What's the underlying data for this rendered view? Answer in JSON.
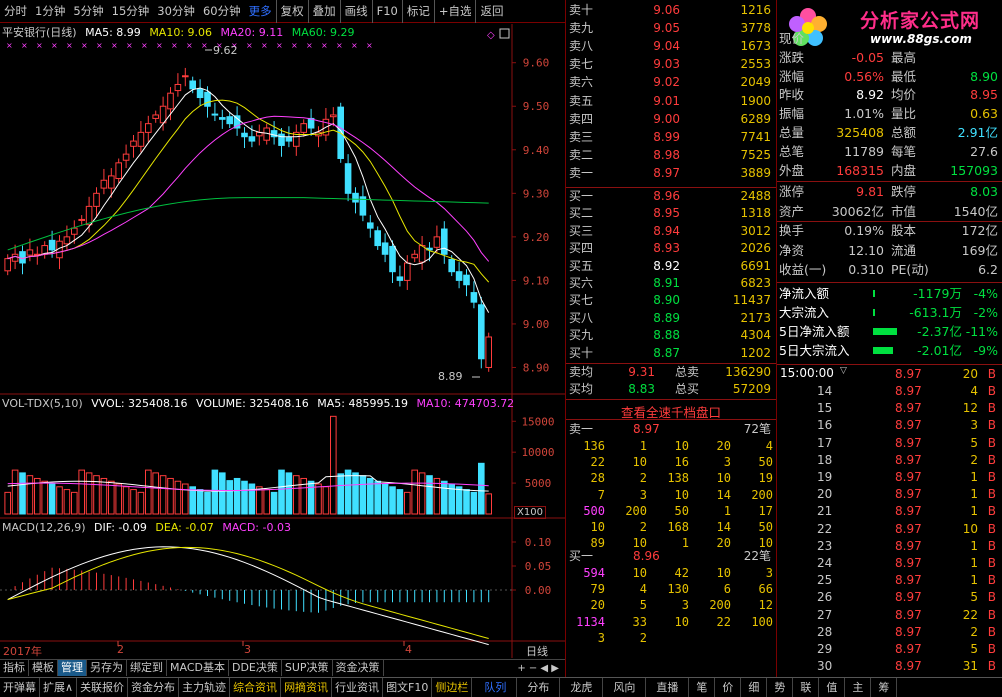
{
  "toolbar": {
    "periods": [
      "分时",
      "1分钟",
      "5分钟",
      "15分钟",
      "30分钟",
      "60分钟"
    ],
    "more": "更多",
    "buttons": [
      "复权",
      "叠加",
      "画线",
      "F10",
      "标记",
      "+自选",
      "返回"
    ]
  },
  "chart_header": {
    "name": "平安银行(日线)",
    "ma5": "MA5: 8.99",
    "ma10": "MA10: 9.06",
    "ma20": "MA20: 9.11",
    "ma60": "MA60: 9.29"
  },
  "price_axis": [
    "9.60",
    "9.50",
    "9.40",
    "9.30",
    "9.20",
    "9.10",
    "9.00",
    "8.90"
  ],
  "high_label": "9.62",
  "low_label": "8.89",
  "vol_header": {
    "name": "VOL-TDX(5,10)",
    "vvol": "VVOL: 325408.16",
    "volume": "VOLUME: 325408.16",
    "ma5": "MA5: 485995.19",
    "ma10": "MA10: 474703.72"
  },
  "vol_axis": [
    "15000",
    "10000",
    "5000"
  ],
  "vol_unit": "X100",
  "macd_header": {
    "name": "MACD(12,26,9)",
    "dif": "DIF: -0.09",
    "dea": "DEA: -0.07",
    "macd": "MACD: -0.03"
  },
  "macd_axis": [
    "0.10",
    "0.05",
    "0.00"
  ],
  "date_axis": {
    "year": "2017年",
    "m2": "2",
    "m3": "3",
    "m4": "4",
    "period": "日线"
  },
  "bottom_tabs": [
    "指标",
    "模板",
    "管理",
    "另存为",
    "绑定到",
    "MACD基本",
    "DDE决策",
    "SUP决策",
    "资金决策"
  ],
  "status_bar": [
    "开弹幕",
    "扩展∧",
    "关联报价",
    "资金分布",
    "主力轨迹",
    "综合资讯",
    "网摘资讯",
    "行业资讯",
    "图文F10",
    "侧边栏"
  ],
  "status_bar_right": [
    "队列",
    "分布",
    "龙虎",
    "风向",
    "直播",
    "笔",
    "价",
    "细",
    "势",
    "联",
    "值",
    "主",
    "筹"
  ],
  "order_book": {
    "asks": [
      {
        "label": "卖十",
        "price": "9.06",
        "vol": "1216"
      },
      {
        "label": "卖九",
        "price": "9.05",
        "vol": "3778"
      },
      {
        "label": "卖八",
        "price": "9.04",
        "vol": "1673"
      },
      {
        "label": "卖七",
        "price": "9.03",
        "vol": "2553"
      },
      {
        "label": "卖六",
        "price": "9.02",
        "vol": "2049"
      },
      {
        "label": "卖五",
        "price": "9.01",
        "vol": "1900"
      },
      {
        "label": "卖四",
        "price": "9.00",
        "vol": "6289"
      },
      {
        "label": "卖三",
        "price": "8.99",
        "vol": "7741"
      },
      {
        "label": "卖二",
        "price": "8.98",
        "vol": "7525"
      },
      {
        "label": "卖一",
        "price": "8.97",
        "vol": "3889"
      }
    ],
    "bids": [
      {
        "label": "买一",
        "price": "8.96",
        "vol": "2488"
      },
      {
        "label": "买二",
        "price": "8.95",
        "vol": "1318"
      },
      {
        "label": "买三",
        "price": "8.94",
        "vol": "3012"
      },
      {
        "label": "买四",
        "price": "8.93",
        "vol": "2026"
      },
      {
        "label": "买五",
        "price": "8.92",
        "vol": "6691"
      },
      {
        "label": "买六",
        "price": "8.91",
        "vol": "6823"
      },
      {
        "label": "买七",
        "price": "8.90",
        "vol": "11437"
      },
      {
        "label": "买八",
        "price": "8.89",
        "vol": "2173"
      },
      {
        "label": "买九",
        "price": "8.88",
        "vol": "4304"
      },
      {
        "label": "买十",
        "price": "8.87",
        "vol": "1202"
      }
    ],
    "sell_avg": {
      "label": "卖均",
      "price": "9.31",
      "tlabel": "总卖",
      "vol": "136290"
    },
    "buy_avg": {
      "label": "买均",
      "price": "8.83",
      "tlabel": "总买",
      "vol": "57209"
    }
  },
  "queue_link": "查看全速千档盘口",
  "ask_queue": {
    "label": "卖一",
    "price": "8.97",
    "count": "72笔",
    "rows": [
      [
        "136",
        "1",
        "10",
        "20",
        "4"
      ],
      [
        "22",
        "10",
        "16",
        "3",
        "50"
      ],
      [
        "28",
        "2",
        "138",
        "10",
        "19"
      ],
      [
        "7",
        "3",
        "10",
        "14",
        "200"
      ],
      [
        "500",
        "200",
        "50",
        "1",
        "17"
      ],
      [
        "10",
        "2",
        "168",
        "14",
        "50"
      ],
      [
        "89",
        "10",
        "1",
        "20",
        "10"
      ]
    ]
  },
  "bid_queue": {
    "label": "买一",
    "price": "8.96",
    "count": "22笔",
    "rows": [
      [
        "594",
        "10",
        "42",
        "10",
        "3"
      ],
      [
        "79",
        "4",
        "130",
        "6",
        "66"
      ],
      [
        "20",
        "5",
        "3",
        "200",
        "12"
      ],
      [
        "1134",
        "33",
        "10",
        "22",
        "100"
      ],
      [
        "3",
        "2",
        "",
        "",
        ""
      ]
    ]
  },
  "logo": {
    "title": "分析家公式网",
    "url": "www.88gs.com"
  },
  "quote": [
    {
      "l1": "现价",
      "v1": "",
      "l2": "",
      "v2": ""
    },
    {
      "l1": "涨跌",
      "v1": "-0.05",
      "l2": "最高",
      "v2": ""
    },
    {
      "l1": "涨幅",
      "v1": "0.56%",
      "l2": "最低",
      "v2": "8.90"
    },
    {
      "l1": "昨收",
      "v1": "8.92",
      "l2": "均价",
      "v2": "8.95"
    },
    {
      "l1": "振幅",
      "v1": "1.01%",
      "l2": "量比",
      "v2": "0.63"
    },
    {
      "l1": "总量",
      "v1": "325408",
      "l2": "总额",
      "v2": "2.91亿"
    },
    {
      "l1": "总笔",
      "v1": "11789",
      "l2": "每笔",
      "v2": "27.6"
    },
    {
      "l1": "外盘",
      "v1": "168315",
      "l2": "内盘",
      "v2": "157093"
    }
  ],
  "quote2": [
    {
      "l1": "涨停",
      "v1": "9.81",
      "l2": "跌停",
      "v2": "8.03"
    },
    {
      "l1": "资产",
      "v1": "30062亿",
      "l2": "市值",
      "v2": "1540亿"
    },
    {
      "l1": "换手",
      "v1": "0.19%",
      "l2": "股本",
      "v2": "172亿"
    },
    {
      "l1": "净资",
      "v1": "12.10",
      "l2": "流通",
      "v2": "169亿"
    },
    {
      "l1": "收益(一)",
      "v1": "0.310",
      "l2": "PE(动)",
      "v2": "6.2"
    }
  ],
  "flows": [
    {
      "label": "净流入额",
      "value": "-1179万",
      "pct": "-4%"
    },
    {
      "label": "大宗流入",
      "value": "-613.1万",
      "pct": "-2%"
    },
    {
      "label": "5日净流入额",
      "value": "-2.37亿",
      "pct": "-11%"
    },
    {
      "label": "5日大宗流入",
      "value": "-2.01亿",
      "pct": "-9%"
    }
  ],
  "ticks_header": "15:00:00",
  "ticks": [
    {
      "t": "14",
      "p": "8.97",
      "v": "4",
      "d": "B"
    },
    {
      "t": "15",
      "p": "8.97",
      "v": "12",
      "d": "B"
    },
    {
      "t": "16",
      "p": "8.97",
      "v": "3",
      "d": "B"
    },
    {
      "t": "17",
      "p": "8.97",
      "v": "5",
      "d": "B"
    },
    {
      "t": "18",
      "p": "8.97",
      "v": "2",
      "d": "B"
    },
    {
      "t": "19",
      "p": "8.97",
      "v": "1",
      "d": "B"
    },
    {
      "t": "20",
      "p": "8.97",
      "v": "1",
      "d": "B"
    },
    {
      "t": "21",
      "p": "8.97",
      "v": "1",
      "d": "B"
    },
    {
      "t": "22",
      "p": "8.97",
      "v": "10",
      "d": "B"
    },
    {
      "t": "23",
      "p": "8.97",
      "v": "1",
      "d": "B"
    },
    {
      "t": "24",
      "p": "8.97",
      "v": "1",
      "d": "B"
    },
    {
      "t": "25",
      "p": "8.97",
      "v": "1",
      "d": "B"
    },
    {
      "t": "26",
      "p": "8.97",
      "v": "5",
      "d": "B"
    },
    {
      "t": "27",
      "p": "8.97",
      "v": "22",
      "d": "B"
    },
    {
      "t": "28",
      "p": "8.97",
      "v": "2",
      "d": "B"
    },
    {
      "t": "29",
      "p": "8.97",
      "v": "5",
      "d": "B"
    },
    {
      "t": "30",
      "p": "8.97",
      "v": "31",
      "d": "B"
    }
  ],
  "ticks_top": {
    "t": "",
    "p": "8.97",
    "v": "20",
    "d": "B"
  }
}
